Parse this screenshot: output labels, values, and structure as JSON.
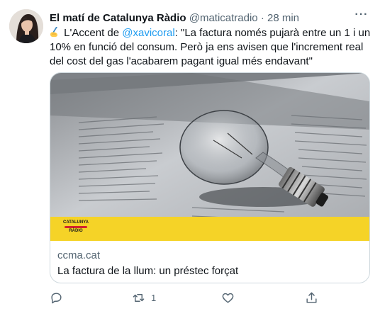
{
  "tweet": {
    "display_name": "El matí de Catalunya Ràdio",
    "handle": "@maticatradio",
    "separator": "·",
    "time": "28 min",
    "more_label": "···",
    "text_prefix": " L'Accent de ",
    "mention": "@xavicoral",
    "text_suffix": ": \"La factura només pujarà entre un 1 i un 10% en funció del consum. Però ja ens avisen que l'increment real del cost del gas l'acabarem pagant igual més endavant\"",
    "emoji_icon": "writing-hand-icon"
  },
  "card": {
    "logo_text": [
      "CATALUNYA",
      "RÀDIO"
    ],
    "domain": "ccma.cat",
    "title": "La factura de la llum: un préstec forçat"
  },
  "actions": {
    "reply_icon": "reply-icon",
    "retweet_icon": "retweet-icon",
    "retweet_count": "1",
    "like_icon": "heart-icon",
    "share_icon": "share-icon"
  },
  "colors": {
    "link": "#1d9bf0",
    "muted": "#536471",
    "border": "#cfd9de",
    "logo_band": "#f5d327"
  }
}
